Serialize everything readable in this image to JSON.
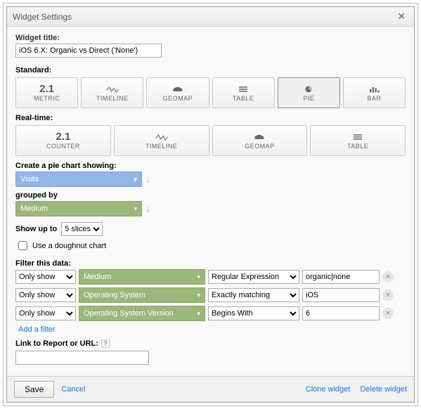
{
  "dialog": {
    "title": "Widget Settings"
  },
  "titleField": {
    "label": "Widget title:",
    "value": "iOS 6.X: Organic vs Direct ('None')"
  },
  "standard": {
    "label": "Standard:",
    "types": [
      {
        "key": "metric",
        "label": "METRIC"
      },
      {
        "key": "timeline",
        "label": "TIMELINE"
      },
      {
        "key": "geomap",
        "label": "GEOMAP"
      },
      {
        "key": "table",
        "label": "TABLE"
      },
      {
        "key": "pie",
        "label": "PIE"
      },
      {
        "key": "bar",
        "label": "BAR"
      }
    ],
    "selected": "pie"
  },
  "realtime": {
    "label": "Real-time:",
    "types": [
      {
        "key": "counter",
        "label": "COUNTER"
      },
      {
        "key": "timeline",
        "label": "TIMELINE"
      },
      {
        "key": "geomap",
        "label": "GEOMAP"
      },
      {
        "key": "table",
        "label": "TABLE"
      }
    ]
  },
  "pieConfig": {
    "header": "Create a pie chart showing:",
    "metric": "Visits",
    "groupedByLabel": "grouped by",
    "dimension": "Medium",
    "showUpToLabel": "Show up to",
    "slices": "5 slices",
    "doughnutLabel": "Use a doughnut chart",
    "doughnut": false
  },
  "filters": {
    "header": "Filter this data:",
    "rows": [
      {
        "mode": "Only show",
        "dimension": "Medium",
        "match": "Regular Expression",
        "value": "organic|none"
      },
      {
        "mode": "Only show",
        "dimension": "Operating System",
        "match": "Exactly matching",
        "value": "iOS"
      },
      {
        "mode": "Only show",
        "dimension": "Operating System Version",
        "match": "Begins With",
        "value": "6"
      }
    ],
    "addLabel": "Add a filter"
  },
  "linkReport": {
    "label": "Link to Report or URL:",
    "value": ""
  },
  "footer": {
    "save": "Save",
    "cancel": "Cancel",
    "clone": "Clone widget",
    "delete": "Delete widget"
  }
}
